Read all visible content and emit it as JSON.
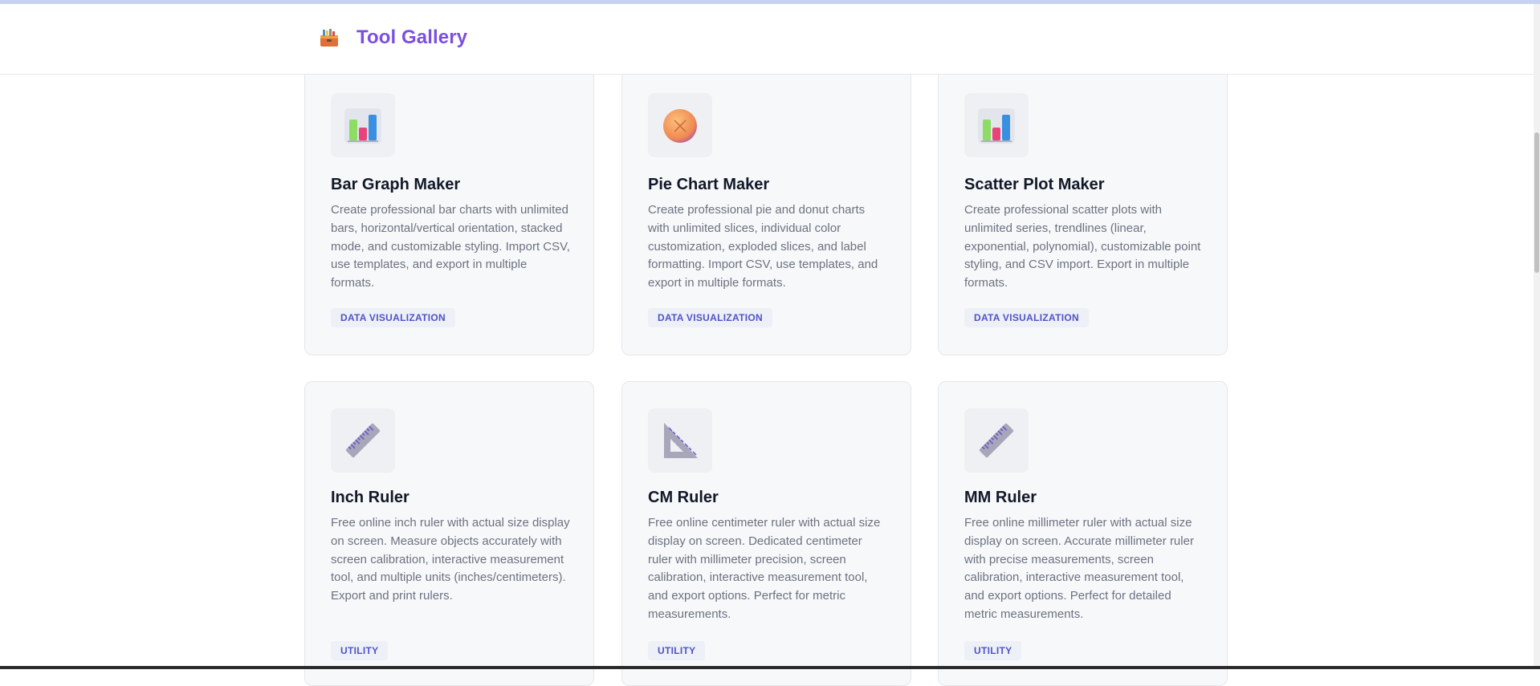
{
  "header": {
    "brand_icon": "toolbox-icon",
    "title": "Tool Gallery"
  },
  "cards": [
    {
      "icon": "bar-chart-icon",
      "title": "Bar Graph Maker",
      "description": "Create professional bar charts with unlimited bars, horizontal/vertical orientation, stacked mode, and customizable styling. Import CSV, use templates, and export in multiple formats.",
      "tag": "DATA VISUALIZATION"
    },
    {
      "icon": "pie-chart-icon",
      "title": "Pie Chart Maker",
      "description": "Create professional pie and donut charts with unlimited slices, individual color customization, exploded slices, and label formatting. Import CSV, use templates, and export in multiple formats.",
      "tag": "DATA VISUALIZATION"
    },
    {
      "icon": "bar-chart-icon",
      "title": "Scatter Plot Maker",
      "description": "Create professional scatter plots with unlimited series, trendlines (linear, exponential, polynomial), customizable point styling, and CSV import. Export in multiple formats.",
      "tag": "DATA VISUALIZATION"
    },
    {
      "icon": "ruler-icon",
      "title": "Inch Ruler",
      "description": "Free online inch ruler with actual size display on screen. Measure objects accurately with screen calibration, interactive measurement tool, and multiple units (inches/centimeters). Export and print rulers.",
      "tag": "UTILITY"
    },
    {
      "icon": "triangular-ruler-icon",
      "title": "CM Ruler",
      "description": "Free online centimeter ruler with actual size display on screen. Dedicated centimeter ruler with millimeter precision, screen calibration, interactive measurement tool, and export options. Perfect for metric measurements.",
      "tag": "UTILITY"
    },
    {
      "icon": "ruler-icon",
      "title": "MM Ruler",
      "description": "Free online millimeter ruler with actual size display on screen. Accurate millimeter ruler with precise measurements, screen calibration, interactive measurement tool, and export options. Perfect for detailed metric measurements.",
      "tag": "UTILITY"
    }
  ]
}
